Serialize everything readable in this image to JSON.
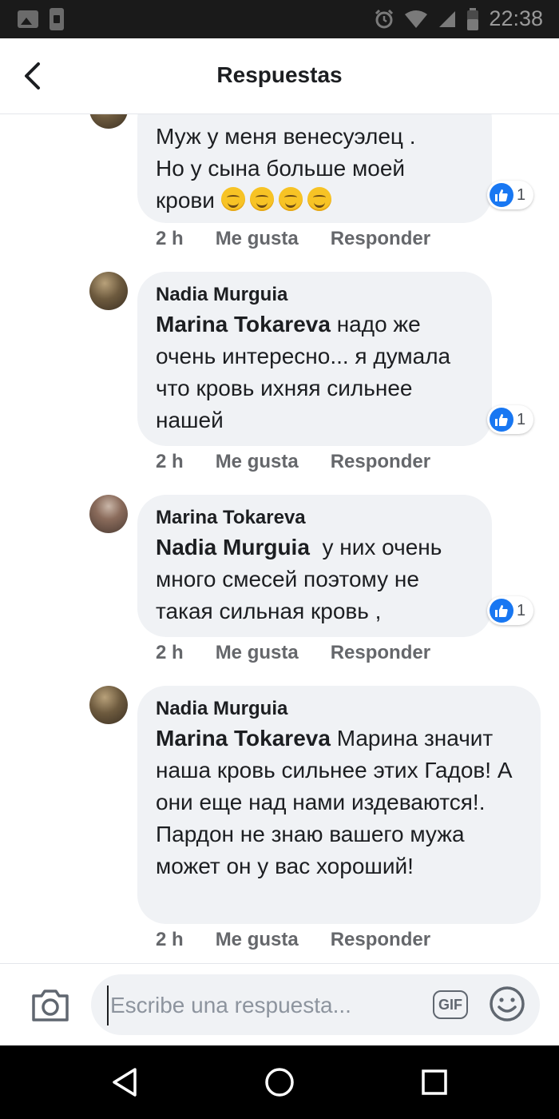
{
  "status_bar": {
    "time": "22:38"
  },
  "header": {
    "title": "Respuestas"
  },
  "comments": [
    {
      "author": "",
      "mention": "",
      "text_lines": [
        "Муж у меня венесуэлец .",
        "Но у сына больше моей",
        "крови"
      ],
      "emoji_count": 4,
      "reactions": "1",
      "time": "2 h",
      "like_label": "Me gusta",
      "reply_label": "Responder"
    },
    {
      "author": "Nadia Murguia",
      "mention": "Marina Tokareva",
      "text": " надо же очень интересно... я думала что кровь ихняя сильнее нашей",
      "reactions": "1",
      "time": "2 h",
      "like_label": "Me gusta",
      "reply_label": "Responder"
    },
    {
      "author": "Marina Tokareva",
      "mention": "Nadia Murguia",
      "text": "  у них очень много смесей поэтому не такая сильная кровь ,",
      "reactions": "1",
      "time": "2 h",
      "like_label": "Me gusta",
      "reply_label": "Responder"
    },
    {
      "author": "Nadia Murguia",
      "mention": "Marina Tokareva",
      "text": " Марина значит наша кровь сильнее этих Гадов! А они еще над нами издеваются!.  Пардон не знаю вашего мужа может он у вас хороший!",
      "reactions": "",
      "time": "2 h",
      "like_label": "Me gusta",
      "reply_label": "Responder"
    }
  ],
  "composer": {
    "placeholder": "Escribe una respuesta...",
    "gif_label": "GIF"
  },
  "icons": {
    "back": "chevron-left-icon",
    "like": "thumbs-up-icon",
    "camera": "camera-icon",
    "emoji": "smiley-icon",
    "nav_back": "triangle-back-icon",
    "nav_home": "circle-home-icon",
    "nav_recent": "square-recent-icon"
  },
  "colors": {
    "accent": "#1877f2",
    "bubble": "#f0f2f5",
    "secondary_text": "#65676b"
  }
}
